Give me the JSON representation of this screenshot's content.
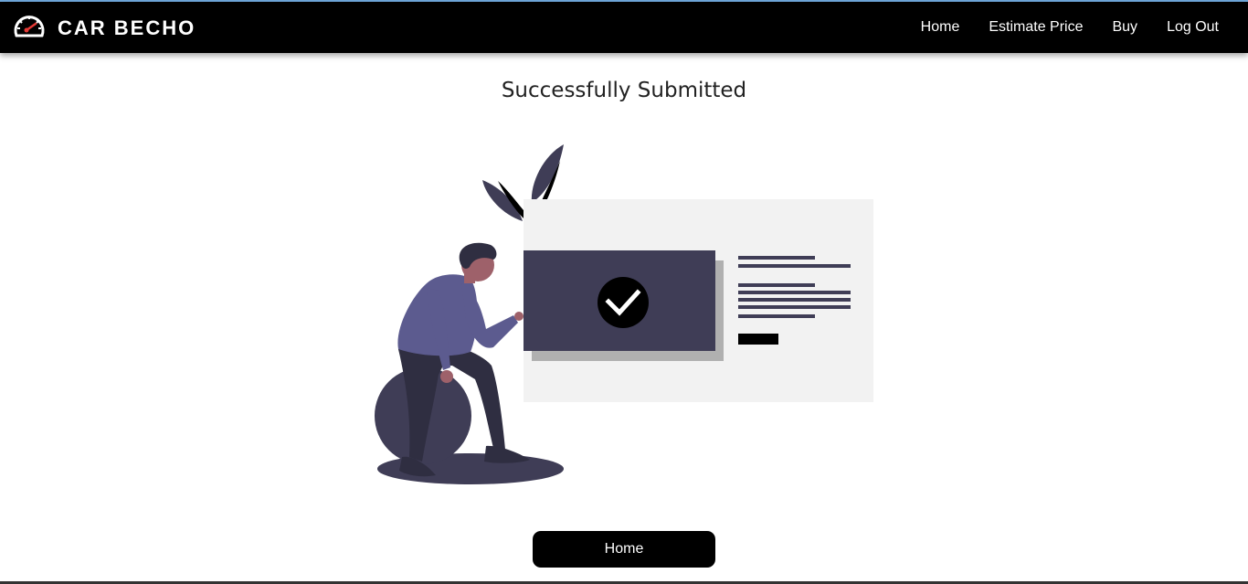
{
  "brand": {
    "name": "CAR BECHO",
    "icon": "speedometer-icon"
  },
  "nav": {
    "items": [
      {
        "label": "Home"
      },
      {
        "label": "Estimate Price"
      },
      {
        "label": "Buy"
      },
      {
        "label": "Log Out"
      }
    ]
  },
  "main": {
    "title": "Successfully Submitted",
    "illustration_icon": "checkmark-icon",
    "home_button": "Home"
  },
  "colors": {
    "navbar_bg": "#000000",
    "accent_dark": "#3f3d56",
    "shirt": "#5c5b8f",
    "panel_bg": "#f2f2f2",
    "gauge_needle": "#e53935"
  }
}
